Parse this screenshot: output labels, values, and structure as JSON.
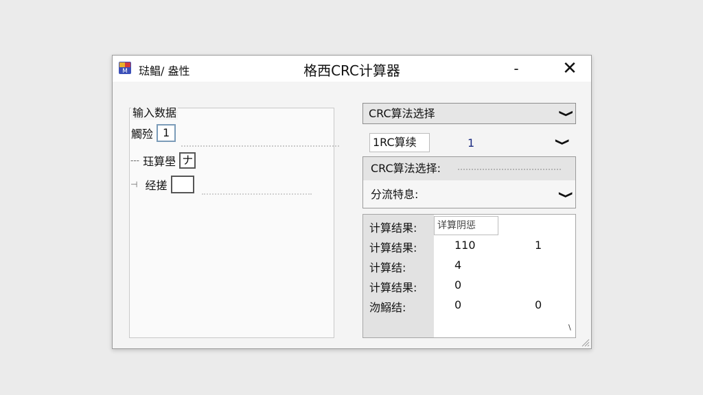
{
  "window": {
    "title": "格西CRC计算器",
    "title_menu": "琺鲳/ 盎性",
    "minimize_glyph": "-",
    "close_glyph": "✕"
  },
  "input_panel": {
    "group_label": "输入数据",
    "rows": [
      {
        "label": "觸殓",
        "box_value": "1"
      },
      {
        "label": "珏算壆",
        "box_value": "ナ"
      },
      {
        "label": "经搓",
        "box_value": ""
      }
    ]
  },
  "algorithm": {
    "dropdown_label": "CRC算法选择",
    "selected_text": "1RC算续",
    "number": "1"
  },
  "options": {
    "row1_label": "CRC算法选择:",
    "row2_label": "分流特息:"
  },
  "results": {
    "input_value": "详算阴惩",
    "rows": [
      {
        "label": "计算结果:",
        "value": "",
        "value2": ""
      },
      {
        "label": "计算结果:",
        "value": "110",
        "value2": "1"
      },
      {
        "label": "计算结:",
        "value": "4",
        "value2": ""
      },
      {
        "label": "计算结果:",
        "value": "0",
        "value2": ""
      },
      {
        "label": "沕鰯结:",
        "value": "0",
        "value2": "0"
      }
    ],
    "corner_mark": "\\"
  },
  "icons": {
    "app": "app-icon",
    "minimize": "minimize-icon",
    "close": "close-icon",
    "chevron": "chevron-down-icon",
    "grip": "resize-grip-icon"
  },
  "colors": {
    "background": "#ebebeb",
    "window": "#f4f4f4",
    "accent_number": "#1a2a80"
  }
}
